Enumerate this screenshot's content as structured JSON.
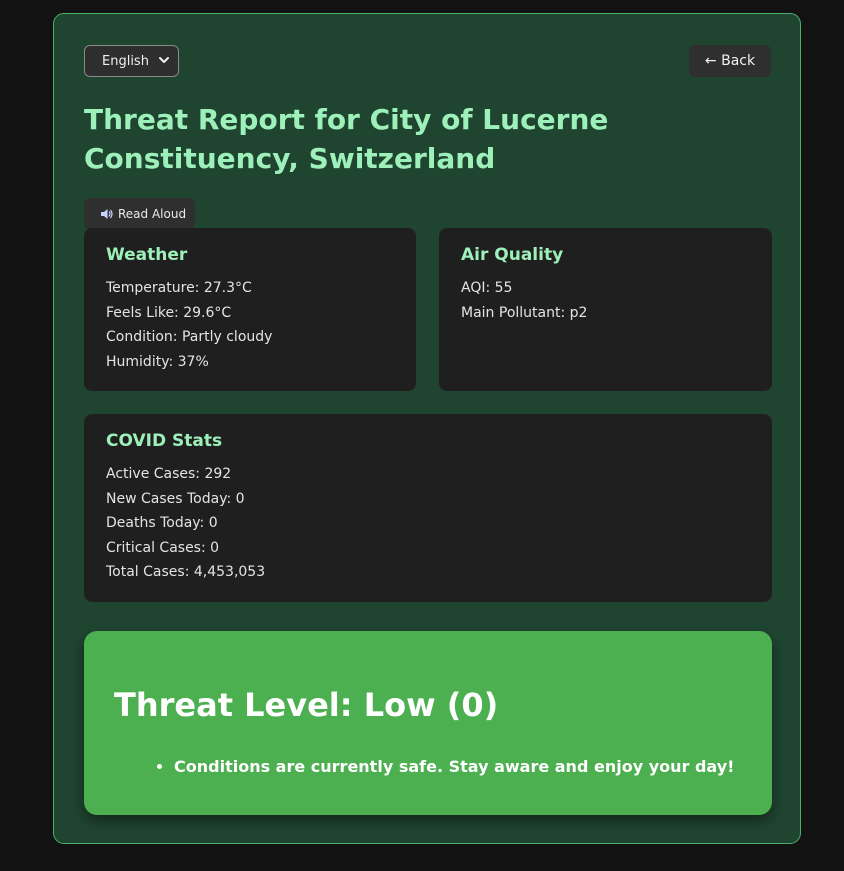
{
  "header": {
    "language": "English",
    "back_label": "← Back",
    "title": "Threat Report for City of Lucerne Constituency, Switzerland",
    "read_aloud_label": "Read Aloud"
  },
  "weather": {
    "heading": "Weather",
    "temperature": "Temperature: 27.3°C",
    "feels_like": "Feels Like: 29.6°C",
    "condition": "Condition: Partly cloudy",
    "humidity": "Humidity: 37%"
  },
  "air_quality": {
    "heading": "Air Quality",
    "aqi": "AQI: 55",
    "main_pollutant": "Main Pollutant: p2"
  },
  "covid": {
    "heading": "COVID Stats",
    "active": "Active Cases: 292",
    "new_today": "New Cases Today: 0",
    "deaths_today": "Deaths Today: 0",
    "critical": "Critical Cases: 0",
    "total": "Total Cases: 4,453,053"
  },
  "threat": {
    "level_text": "Threat Level: Low (0)",
    "advice": [
      "Conditions are currently safe. Stay aware and enjoy your day!"
    ]
  },
  "icons": {
    "language_dropdown": "chevron-down-icon",
    "read_aloud": "speaker-icon"
  },
  "colors": {
    "page_background": "#121212",
    "panel_background": "#1f4531",
    "panel_border": "#4cae6a",
    "accent_heading": "#9df0ba",
    "card_background": "#1f1f1f",
    "threat_background": "#4caf50"
  }
}
